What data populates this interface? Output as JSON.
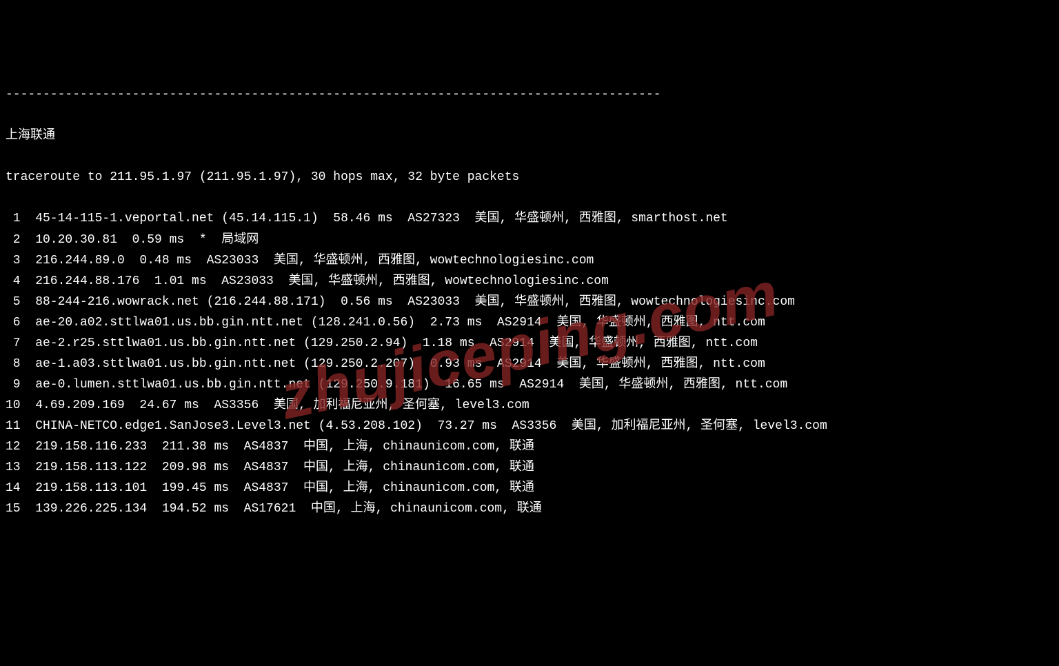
{
  "separator": "----------------------------------------------------------------------------------------",
  "title": "上海联通",
  "trace_line": "traceroute to 211.95.1.97 (211.95.1.97), 30 hops max, 32 byte packets",
  "hops": [
    {
      "n": " 1",
      "text": "45-14-115-1.veportal.net (45.14.115.1)  58.46 ms  AS27323  美国, 华盛顿州, 西雅图, smarthost.net"
    },
    {
      "n": " 2",
      "text": "10.20.30.81  0.59 ms  *  局域网"
    },
    {
      "n": " 3",
      "text": "216.244.89.0  0.48 ms  AS23033  美国, 华盛顿州, 西雅图, wowtechnologiesinc.com"
    },
    {
      "n": " 4",
      "text": "216.244.88.176  1.01 ms  AS23033  美国, 华盛顿州, 西雅图, wowtechnologiesinc.com"
    },
    {
      "n": " 5",
      "text": "88-244-216.wowrack.net (216.244.88.171)  0.56 ms  AS23033  美国, 华盛顿州, 西雅图, wowtechnologiesinc.com"
    },
    {
      "n": " 6",
      "text": "ae-20.a02.sttlwa01.us.bb.gin.ntt.net (128.241.0.56)  2.73 ms  AS2914  美国, 华盛顿州, 西雅图, ntt.com"
    },
    {
      "n": " 7",
      "text": "ae-2.r25.sttlwa01.us.bb.gin.ntt.net (129.250.2.94)  1.18 ms  AS2914  美国, 华盛顿州, 西雅图, ntt.com"
    },
    {
      "n": " 8",
      "text": "ae-1.a03.sttlwa01.us.bb.gin.ntt.net (129.250.2.207)  0.93 ms  AS2914  美国, 华盛顿州, 西雅图, ntt.com"
    },
    {
      "n": " 9",
      "text": "ae-0.lumen.sttlwa01.us.bb.gin.ntt.net (129.250.9.181)  16.65 ms  AS2914  美国, 华盛顿州, 西雅图, ntt.com"
    },
    {
      "n": "10",
      "text": "4.69.209.169  24.67 ms  AS3356  美国, 加利福尼亚州, 圣何塞, level3.com"
    },
    {
      "n": "11",
      "text": "CHINA-NETCO.edge1.SanJose3.Level3.net (4.53.208.102)  73.27 ms  AS3356  美国, 加利福尼亚州, 圣何塞, level3.com"
    },
    {
      "n": "12",
      "text": "219.158.116.233  211.38 ms  AS4837  中国, 上海, chinaunicom.com, 联通"
    },
    {
      "n": "13",
      "text": "219.158.113.122  209.98 ms  AS4837  中国, 上海, chinaunicom.com, 联通"
    },
    {
      "n": "14",
      "text": "219.158.113.101  199.45 ms  AS4837  中国, 上海, chinaunicom.com, 联通"
    },
    {
      "n": "15",
      "text": "139.226.225.134  194.52 ms  AS17621  中国, 上海, chinaunicom.com, 联通"
    }
  ],
  "watermark": "zhujiceping.com"
}
